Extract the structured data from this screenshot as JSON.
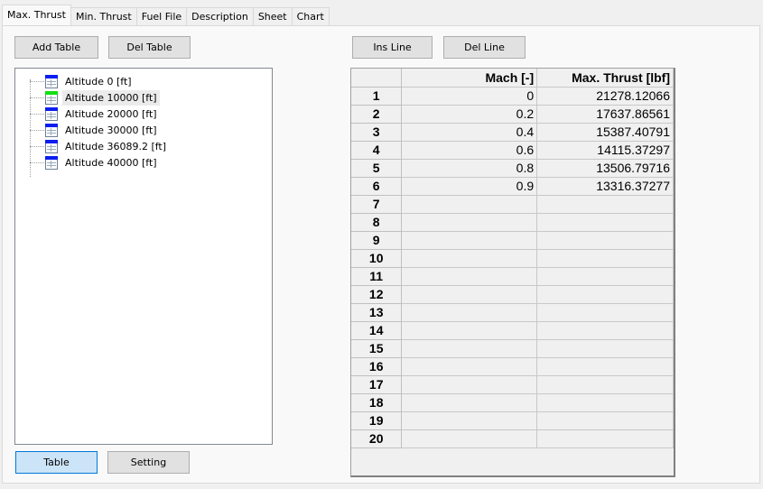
{
  "tabs": [
    {
      "label": "Max. Thrust",
      "active": true
    },
    {
      "label": "Min. Thrust",
      "active": false
    },
    {
      "label": "Fuel File",
      "active": false
    },
    {
      "label": "Description",
      "active": false
    },
    {
      "label": "Sheet",
      "active": false
    },
    {
      "label": "Chart",
      "active": false
    }
  ],
  "left": {
    "add_table_label": "Add Table",
    "del_table_label": "Del Table",
    "tree_items": [
      {
        "label": "Altitude 0 [ft]",
        "icon": "table-icon-blue"
      },
      {
        "label": "Altitude 10000 [ft]",
        "icon": "table-icon-green",
        "selected": true
      },
      {
        "label": "Altitude 20000 [ft]",
        "icon": "table-icon-blue"
      },
      {
        "label": "Altitude 30000 [ft]",
        "icon": "table-icon-blue"
      },
      {
        "label": "Altitude 36089.2 [ft]",
        "icon": "table-icon-blue"
      },
      {
        "label": "Altitude 40000 [ft]",
        "icon": "table-icon-blue"
      }
    ],
    "table_button_label": "Table",
    "setting_button_label": "Setting"
  },
  "right": {
    "ins_line_label": "Ins Line",
    "del_line_label": "Del Line",
    "grid": {
      "columns": [
        "",
        "Mach [-]",
        "Max. Thrust [lbf]"
      ],
      "rows": [
        {
          "n": "1",
          "mach": "0",
          "thrust": "21278.12066"
        },
        {
          "n": "2",
          "mach": "0.2",
          "thrust": "17637.86561"
        },
        {
          "n": "3",
          "mach": "0.4",
          "thrust": "15387.40791"
        },
        {
          "n": "4",
          "mach": "0.6",
          "thrust": "14115.37297"
        },
        {
          "n": "5",
          "mach": "0.8",
          "thrust": "13506.79716"
        },
        {
          "n": "6",
          "mach": "0.9",
          "thrust": "13316.37277"
        },
        {
          "n": "7",
          "mach": "",
          "thrust": ""
        },
        {
          "n": "8",
          "mach": "",
          "thrust": ""
        },
        {
          "n": "9",
          "mach": "",
          "thrust": ""
        },
        {
          "n": "10",
          "mach": "",
          "thrust": ""
        },
        {
          "n": "11",
          "mach": "",
          "thrust": ""
        },
        {
          "n": "12",
          "mach": "",
          "thrust": ""
        },
        {
          "n": "13",
          "mach": "",
          "thrust": ""
        },
        {
          "n": "14",
          "mach": "",
          "thrust": ""
        },
        {
          "n": "15",
          "mach": "",
          "thrust": ""
        },
        {
          "n": "16",
          "mach": "",
          "thrust": ""
        },
        {
          "n": "17",
          "mach": "",
          "thrust": ""
        },
        {
          "n": "18",
          "mach": "",
          "thrust": ""
        },
        {
          "n": "19",
          "mach": "",
          "thrust": ""
        },
        {
          "n": "20",
          "mach": "",
          "thrust": ""
        }
      ]
    }
  }
}
